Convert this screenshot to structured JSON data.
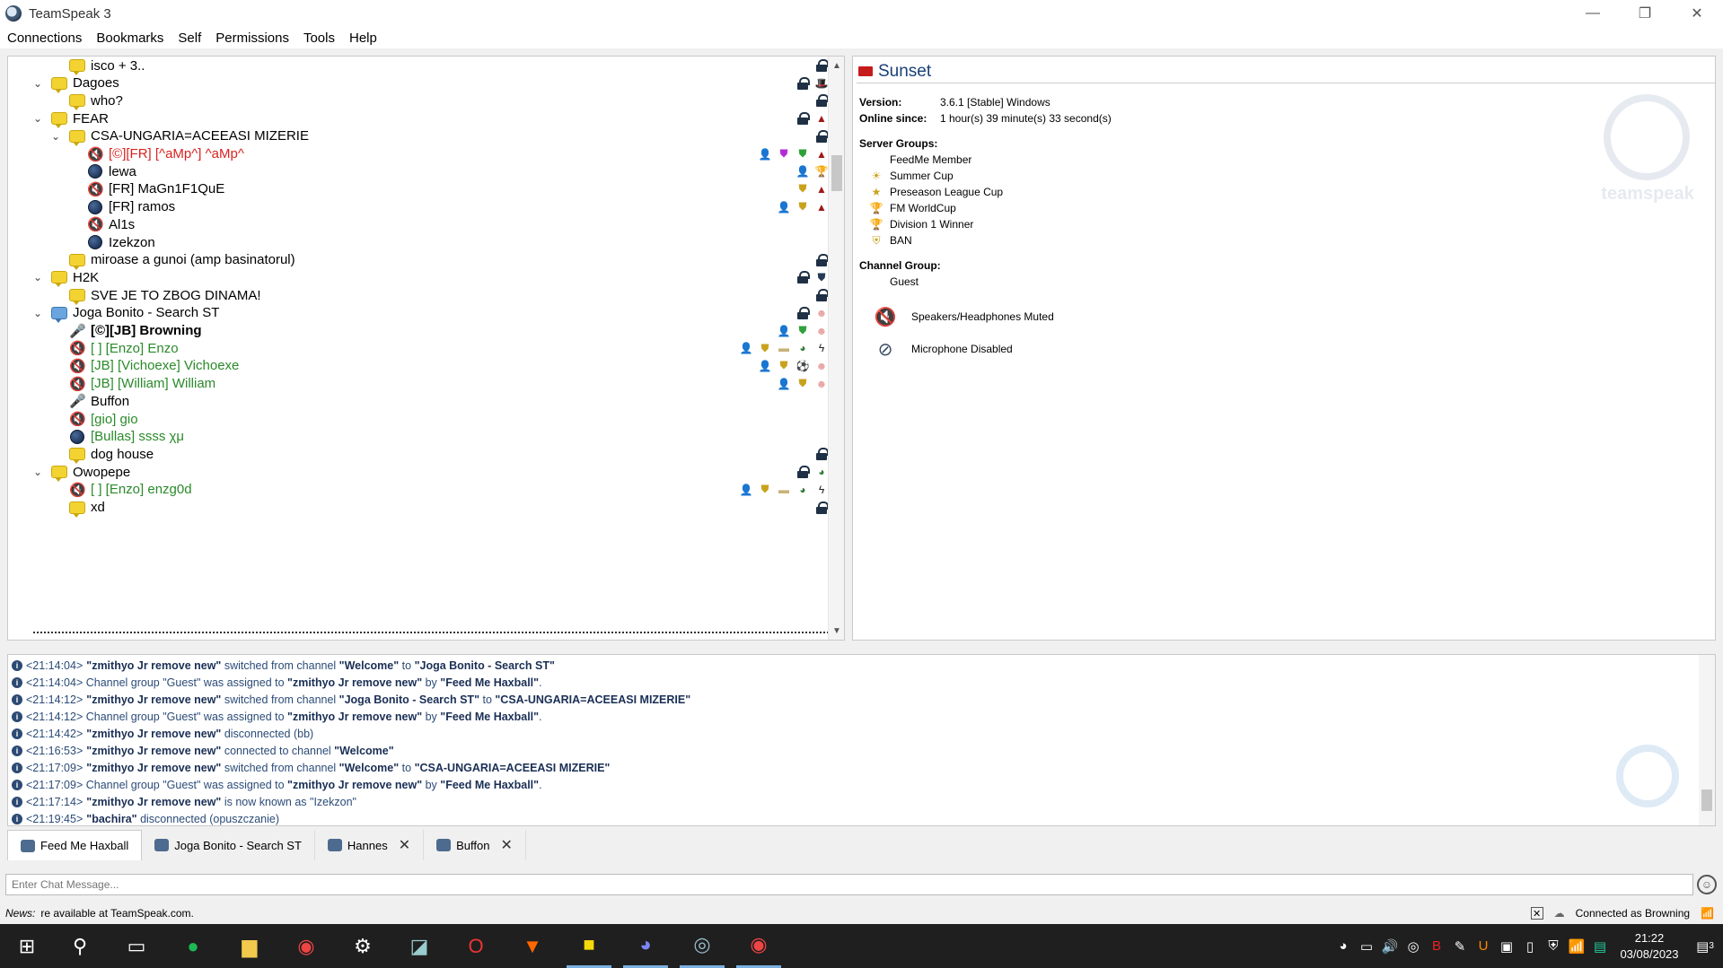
{
  "window": {
    "title": "TeamSpeak 3",
    "minimize": "—",
    "maximize": "❐",
    "close": "✕"
  },
  "menu": [
    "Connections",
    "Bookmarks",
    "Self",
    "Permissions",
    "Tools",
    "Help"
  ],
  "tree": [
    {
      "label": "isco + 3..",
      "type": "channel",
      "indent": 1,
      "flags": [
        "lock"
      ]
    },
    {
      "label": "Dagoes",
      "type": "channel",
      "indent": 0,
      "expanded": true,
      "flags": [
        "lock",
        "hat"
      ]
    },
    {
      "label": "who?",
      "type": "channel",
      "indent": 1,
      "flags": [
        "lock"
      ]
    },
    {
      "label": "FEAR",
      "type": "channel",
      "indent": 0,
      "expanded": true,
      "flags": [
        "lock",
        "red-hood"
      ]
    },
    {
      "label": "CSA-UNGARIA=ACEEASI MIZERIE",
      "type": "channel",
      "indent": 1,
      "expanded": true,
      "flags": [
        "lock"
      ]
    },
    {
      "label": "[©][FR] [^aMp^] ^aMp^",
      "type": "user-muted",
      "indent": 2,
      "color": "#d9231f",
      "flags": [
        "commander",
        "purple-shield",
        "green-shield",
        "red-hood"
      ]
    },
    {
      "label": "lewa",
      "type": "user",
      "indent": 2,
      "flags": [
        "commander",
        "trophy"
      ]
    },
    {
      "label": "[FR] MaGn1F1QuE",
      "type": "user-muted",
      "indent": 2,
      "flags": [
        "gold-shield",
        "red-hood"
      ]
    },
    {
      "label": "[FR] ramos",
      "type": "user",
      "indent": 2,
      "flags": [
        "commander",
        "gold-shield",
        "red-hood"
      ]
    },
    {
      "label": "Al1s",
      "type": "user-muted",
      "indent": 2,
      "flags": []
    },
    {
      "label": "Izekzon",
      "type": "user",
      "indent": 2,
      "flags": []
    },
    {
      "label": "miroase a gunoi (amp basinatorul)",
      "type": "channel",
      "indent": 1,
      "flags": [
        "lock"
      ]
    },
    {
      "label": "H2K",
      "type": "channel",
      "indent": 0,
      "expanded": true,
      "flags": [
        "lock",
        "shield-dark"
      ]
    },
    {
      "label": "SVE JE TO ZBOG DINAMA!",
      "type": "channel",
      "indent": 1,
      "flags": [
        "lock"
      ]
    },
    {
      "label": "Joga Bonito - Search ST",
      "type": "channel-blue",
      "indent": 0,
      "expanded": true,
      "flags": [
        "lock",
        "pink-face"
      ]
    },
    {
      "label": "[©][JB] Browning",
      "type": "user-away",
      "indent": 1,
      "bold": true,
      "flags": [
        "commander",
        "green-shield",
        "pink-face"
      ]
    },
    {
      "label": "[ ] [Enzo] Enzo",
      "type": "user-muted",
      "indent": 1,
      "color": "#2a8a2a",
      "flags": [
        "commander",
        "gold-shield",
        "cigar",
        "frog",
        "wing"
      ]
    },
    {
      "label": "[JB] [Vichoexe] Vichoexe",
      "type": "user-muted",
      "indent": 1,
      "color": "#2a8a2a",
      "flags": [
        "commander",
        "gold-shield",
        "ball",
        "pink-face"
      ]
    },
    {
      "label": "[JB] [William] William",
      "type": "user-muted",
      "indent": 1,
      "color": "#2a8a2a",
      "flags": [
        "commander",
        "gold-shield",
        "pink-face"
      ]
    },
    {
      "label": "Buffon",
      "type": "user-away",
      "indent": 1,
      "flags": []
    },
    {
      "label": "[gio] gio",
      "type": "user-muted",
      "indent": 1,
      "color": "#2a8a2a",
      "flags": []
    },
    {
      "label": "[Bullas] ssss χμ",
      "type": "user",
      "indent": 1,
      "color": "#2a8a2a",
      "flags": []
    },
    {
      "label": "dog house",
      "type": "channel",
      "indent": 1,
      "flags": [
        "lock"
      ]
    },
    {
      "label": "Owopepe",
      "type": "channel",
      "indent": 0,
      "expanded": true,
      "flags": [
        "lock",
        "frog"
      ]
    },
    {
      "label": "[ ] [Enzo] enzg0d",
      "type": "user-muted",
      "indent": 1,
      "color": "#2a8a2a",
      "flags": [
        "commander",
        "gold-shield",
        "cigar",
        "frog",
        "wing"
      ]
    },
    {
      "label": "xd",
      "type": "channel",
      "indent": 1,
      "flags": [
        "lock"
      ]
    }
  ],
  "info": {
    "server_name": "Sunset",
    "version_label": "Version:",
    "version": "3.6.1 [Stable] Windows",
    "online_label": "Online since:",
    "online": "1 hour(s) 39 minute(s) 33 second(s)",
    "server_groups_label": "Server Groups:",
    "server_groups": [
      {
        "name": "FeedMe Member",
        "icon": ""
      },
      {
        "name": "Summer Cup",
        "icon": "☀"
      },
      {
        "name": "Preseason League Cup",
        "icon": "★"
      },
      {
        "name": "FM WorldCup",
        "icon": "🏆"
      },
      {
        "name": "Division 1 Winner",
        "icon": "🏆"
      },
      {
        "name": "BAN",
        "icon": "⛨"
      }
    ],
    "channel_group_label": "Channel Group:",
    "channel_group": "Guest",
    "status": [
      {
        "text": "Speakers/Headphones Muted",
        "icon": "speaker-muted-icon"
      },
      {
        "text": "Microphone Disabled",
        "icon": "mic-disabled-icon"
      }
    ],
    "watermark": "teamspeak"
  },
  "log": [
    {
      "time": "<21:14:04>",
      "parts": [
        [
          "b",
          "\"zmithyo Jr remove new\""
        ],
        [
          "r",
          " switched from channel "
        ],
        [
          "b",
          "\"Welcome\""
        ],
        [
          "r",
          " to "
        ],
        [
          "b",
          "\"Joga Bonito - Search ST\""
        ]
      ]
    },
    {
      "time": "<21:14:04>",
      "parts": [
        [
          "r",
          " Channel group \"Guest\" was assigned to "
        ],
        [
          "b",
          "\"zmithyo Jr remove new\""
        ],
        [
          "r",
          " by "
        ],
        [
          "b",
          "\"Feed Me Haxball\""
        ],
        [
          "r",
          "."
        ]
      ]
    },
    {
      "time": "<21:14:12>",
      "parts": [
        [
          "b",
          "\"zmithyo Jr remove new\""
        ],
        [
          "r",
          " switched from channel "
        ],
        [
          "b",
          "\"Joga Bonito - Search ST\""
        ],
        [
          "r",
          " to "
        ],
        [
          "b",
          "\"CSA-UNGARIA=ACEEASI MIZERIE\""
        ]
      ]
    },
    {
      "time": "<21:14:12>",
      "parts": [
        [
          "r",
          " Channel group \"Guest\" was assigned to "
        ],
        [
          "b",
          "\"zmithyo Jr remove new\""
        ],
        [
          "r",
          " by "
        ],
        [
          "b",
          "\"Feed Me Haxball\""
        ],
        [
          "r",
          "."
        ]
      ]
    },
    {
      "time": "<21:14:42>",
      "parts": [
        [
          "b",
          "\"zmithyo Jr remove new\""
        ],
        [
          "r",
          " disconnected (bb)"
        ]
      ]
    },
    {
      "time": "<21:16:53>",
      "parts": [
        [
          "b",
          "\"zmithyo Jr remove new\""
        ],
        [
          "r",
          " connected to channel "
        ],
        [
          "b",
          "\"Welcome\""
        ]
      ]
    },
    {
      "time": "<21:17:09>",
      "parts": [
        [
          "b",
          "\"zmithyo Jr remove new\""
        ],
        [
          "r",
          " switched from channel "
        ],
        [
          "b",
          "\"Welcome\""
        ],
        [
          "r",
          " to "
        ],
        [
          "b",
          "\"CSA-UNGARIA=ACEEASI MIZERIE\""
        ]
      ]
    },
    {
      "time": "<21:17:09>",
      "parts": [
        [
          "r",
          " Channel group \"Guest\" was assigned to "
        ],
        [
          "b",
          "\"zmithyo Jr remove new\""
        ],
        [
          "r",
          " by "
        ],
        [
          "b",
          "\"Feed Me Haxball\""
        ],
        [
          "r",
          "."
        ]
      ]
    },
    {
      "time": "<21:17:14>",
      "parts": [
        [
          "b",
          "\"zmithyo Jr remove new\""
        ],
        [
          "r",
          " is now known as \"Izekzon\""
        ]
      ]
    },
    {
      "time": "<21:19:45>",
      "parts": [
        [
          "b",
          "\"bachira\""
        ],
        [
          "r",
          " disconnected (opuszczanie)"
        ]
      ]
    }
  ],
  "tabs": [
    {
      "label": "Feed Me Haxball",
      "active": true,
      "closable": false
    },
    {
      "label": "Joga Bonito - Search ST",
      "active": false,
      "closable": false
    },
    {
      "label": "Hannes",
      "active": false,
      "closable": true
    },
    {
      "label": "Buffon",
      "active": false,
      "closable": true
    }
  ],
  "chat": {
    "placeholder": "Enter Chat Message..."
  },
  "statusbar": {
    "news_label": "News:",
    "news_text": "re available at TeamSpeak.com.",
    "connection": "Connected as Browning"
  },
  "taskbar": {
    "apps": [
      "start",
      "search",
      "explorer-window",
      "spotify",
      "file-explorer",
      "chrome",
      "settings",
      "notepad",
      "opera",
      "brave",
      "sticky-notes",
      "discord",
      "teamspeak",
      "chrome-2"
    ],
    "time": "21:22",
    "date": "03/08/2023",
    "notifications": "3"
  }
}
